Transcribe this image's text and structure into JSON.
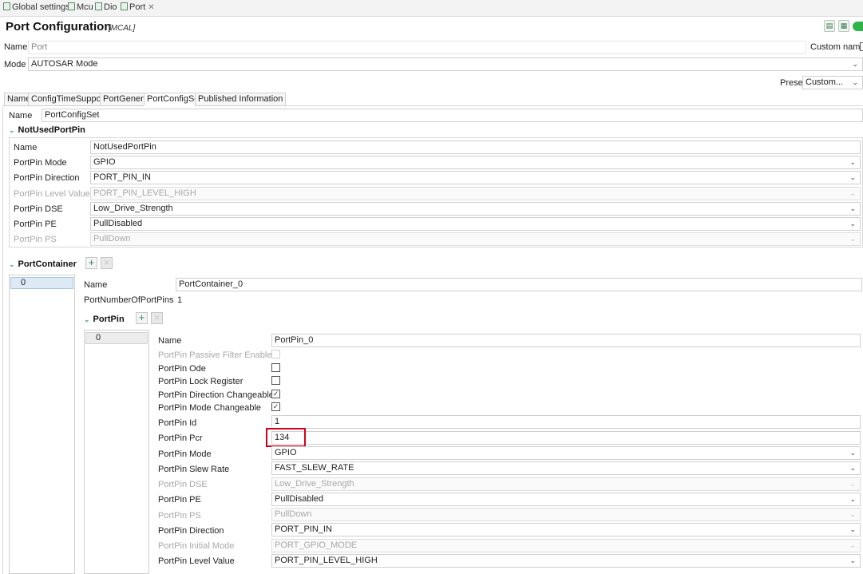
{
  "tabs": [
    {
      "label": "Global settings"
    },
    {
      "label": "Mcu"
    },
    {
      "label": "Dio"
    },
    {
      "label": "Port",
      "close": "✕"
    }
  ],
  "header": {
    "title": "Port Configuration",
    "subtitle": "[MCAL]"
  },
  "top_fields": {
    "name_label": "Name",
    "name_value": "Port",
    "custom_name_label": "Custom name",
    "mode_label": "Mode",
    "mode_value": "AUTOSAR Mode",
    "preset_label": "Preset",
    "preset_value": "Custom..."
  },
  "subtabs": [
    "Name",
    "ConfigTimeSupport",
    "PortGeneral",
    "PortConfigSet",
    "Published Information"
  ],
  "config_set": {
    "name_label": "Name",
    "name_value": "PortConfigSet"
  },
  "not_used": {
    "title": "NotUsedPortPin",
    "rows": [
      {
        "label": "Name",
        "value": "NotUsedPortPin"
      },
      {
        "label": "PortPin Mode",
        "value": "GPIO"
      },
      {
        "label": "PortPin Direction",
        "value": "PORT_PIN_IN"
      },
      {
        "label": "PortPin Level Value",
        "value": "PORT_PIN_LEVEL_HIGH"
      },
      {
        "label": "PortPin DSE",
        "value": "Low_Drive_Strength"
      },
      {
        "label": "PortPin PE",
        "value": "PullDisabled"
      },
      {
        "label": "PortPin PS",
        "value": "PullDown"
      }
    ]
  },
  "port_container": {
    "title": "PortContainer",
    "add": "+",
    "remove": "×",
    "list": [
      "0"
    ],
    "name_label": "Name",
    "name_value": "PortContainer_0",
    "num_pins_label": "PortNumberOfPortPins",
    "num_pins_value": "1"
  },
  "port_pin": {
    "title": "PortPin",
    "add": "+",
    "remove": "×",
    "list": [
      "0"
    ],
    "check": "✓",
    "rows": [
      {
        "label": "Name",
        "value": "PortPin_0"
      },
      {
        "label": "PortPin Passive Filter Enable"
      },
      {
        "label": "PortPin Ode"
      },
      {
        "label": "PortPin Lock Register"
      },
      {
        "label": "PortPin Direction Changeable"
      },
      {
        "label": "PortPin Mode Changeable"
      },
      {
        "label": "PortPin Id",
        "value": "1"
      },
      {
        "label": "PortPin Pcr",
        "value": "134"
      },
      {
        "label": "PortPin Mode",
        "value": "GPIO"
      },
      {
        "label": "PortPin Slew Rate",
        "value": "FAST_SLEW_RATE"
      },
      {
        "label": "PortPin DSE",
        "value": "Low_Drive_Strength"
      },
      {
        "label": "PortPin PE",
        "value": "PullDisabled"
      },
      {
        "label": "PortPin PS",
        "value": "PullDown"
      },
      {
        "label": "PortPin Direction",
        "value": "PORT_PIN_IN"
      },
      {
        "label": "PortPin Initial Mode",
        "value": "PORT_GPIO_MODE"
      },
      {
        "label": "PortPin Level Value",
        "value": "PORT_PIN_LEVEL_HIGH"
      }
    ]
  },
  "dropdown_arrow": "⌄",
  "chevron": "⌄",
  "toolbar": {
    "btn1": "▤",
    "btn2": "▦"
  }
}
